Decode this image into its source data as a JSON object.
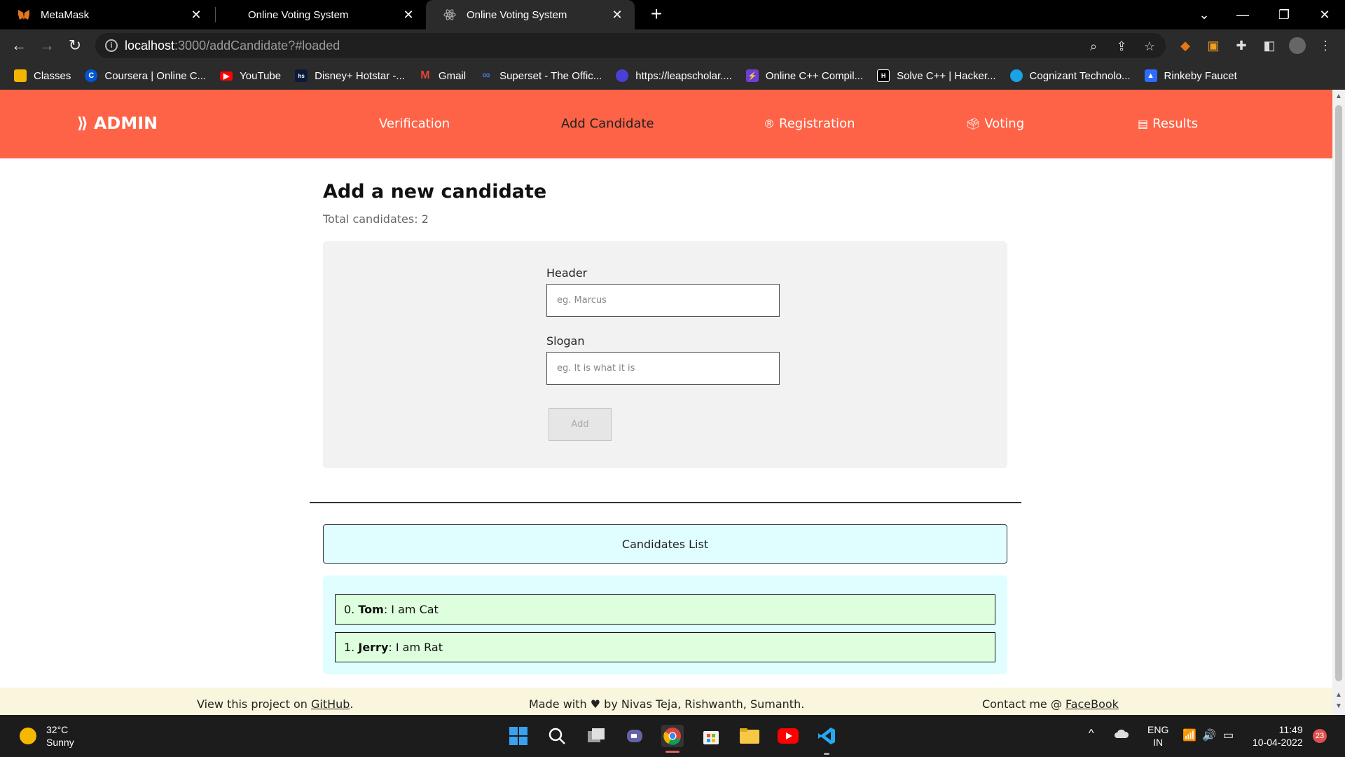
{
  "browser": {
    "tabs": [
      {
        "title": "MetaMask",
        "active": false,
        "icon": "metamask-fox-icon"
      },
      {
        "title": "Online Voting System",
        "active": false,
        "icon": "none"
      },
      {
        "title": "Online Voting System",
        "active": true,
        "icon": "react-icon"
      }
    ],
    "new_tab": "+",
    "url_host": "localhost",
    "url_rest": ":3000/addCandidate?#loaded",
    "bookmarks": [
      {
        "label": "Classes",
        "icon": "classroom-icon",
        "color": "#f4b400"
      },
      {
        "label": "Coursera | Online C...",
        "icon": "coursera-icon",
        "color": "#0056d2"
      },
      {
        "label": "YouTube",
        "icon": "youtube-icon",
        "color": "#ff0000"
      },
      {
        "label": "Disney+ Hotstar -...",
        "icon": "hotstar-icon",
        "color": "#0c1a3a"
      },
      {
        "label": "Gmail",
        "icon": "gmail-icon",
        "color": "#ea4335"
      },
      {
        "label": "Superset - The Offic...",
        "icon": "superset-icon",
        "color": "#4a6fd6"
      },
      {
        "label": "https://leapscholar....",
        "icon": "leapscholar-icon",
        "color": "#4b3fd6"
      },
      {
        "label": "Online C++ Compil...",
        "icon": "compiler-icon",
        "color": "#6b3fd6"
      },
      {
        "label": "Solve C++ | Hacker...",
        "icon": "hackerrank-icon",
        "color": "#000000"
      },
      {
        "label": "Cognizant Technolo...",
        "icon": "cognizant-icon",
        "color": "#1aa1e6"
      },
      {
        "label": "Rinkeby Faucet",
        "icon": "faucet-icon",
        "color": "#2f6bff"
      }
    ]
  },
  "navbar": {
    "brand": "ADMIN",
    "links": [
      {
        "label": "Verification",
        "icon": "",
        "active": false
      },
      {
        "label": "Add Candidate",
        "icon": "",
        "active": true
      },
      {
        "label": "Registration",
        "icon": "registered-icon",
        "active": false
      },
      {
        "label": "Voting",
        "icon": "ballot-box-icon",
        "active": false
      },
      {
        "label": "Results",
        "icon": "poll-icon",
        "active": false
      }
    ],
    "bg_color": "#ff6347"
  },
  "main": {
    "title": "Add a new candidate",
    "total_candidates": "Total candidates: 2",
    "form": {
      "header_label": "Header",
      "header_placeholder": "eg. Marcus",
      "slogan_label": "Slogan",
      "slogan_placeholder": "eg. It is what it is",
      "add_button": "Add"
    },
    "list_title": "Candidates List",
    "candidates": [
      {
        "index": "0.",
        "name": "Tom",
        "slogan": ": I am Cat"
      },
      {
        "index": "1.",
        "name": "Jerry",
        "slogan": ": I am Rat"
      }
    ]
  },
  "footer": {
    "left_text": "View this project on ",
    "left_link": "GitHub",
    "left_end": ".",
    "center_pre": "Made with ",
    "center_post": " by Nivas Teja, Rishwanth, Sumanth.",
    "right_text": "Contact me @ ",
    "right_link": "FaceBook"
  },
  "taskbar": {
    "temperature": "32°C",
    "weather": "Sunny",
    "lang_top": "ENG",
    "lang_bottom": "IN",
    "time": "11:49",
    "date": "10-04-2022",
    "notifications": "23"
  }
}
